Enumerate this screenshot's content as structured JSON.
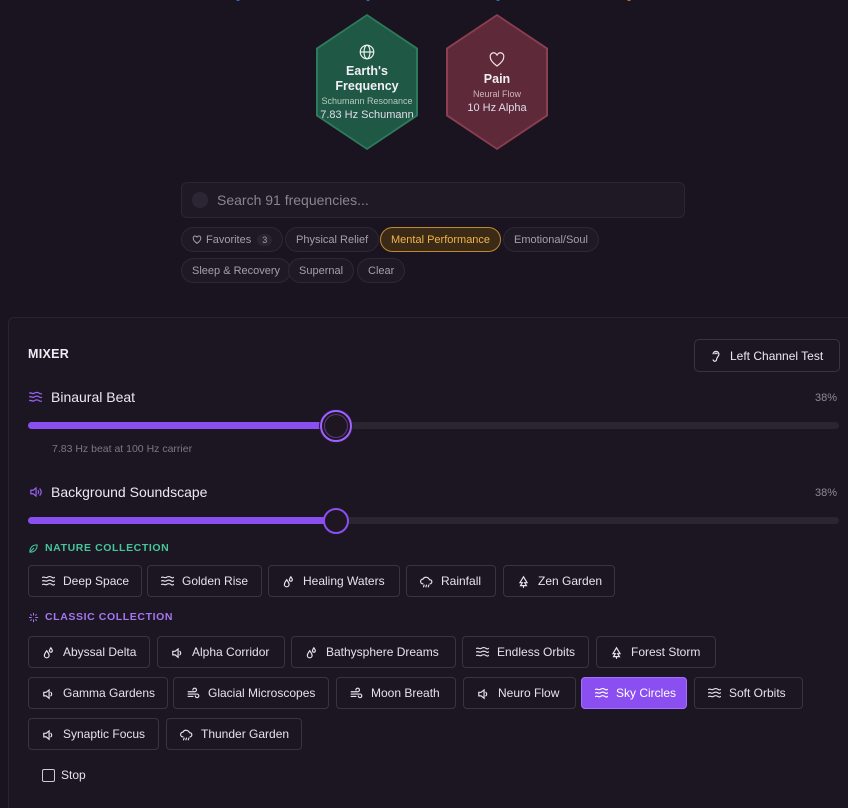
{
  "featured": [
    {
      "title_line1": "Earth's",
      "title_line2": "Frequency",
      "subtitle": "Schumann Resonance",
      "hz": "7.83 Hz Schumann",
      "icon": "globe-icon"
    },
    {
      "title_line1": "Pain",
      "title_line2": "",
      "subtitle": "Neural Flow",
      "hz": "10 Hz Alpha",
      "icon": "heart-icon"
    }
  ],
  "search": {
    "placeholder": "Search 91 frequencies..."
  },
  "filters": {
    "favorites": {
      "label": "Favorites",
      "count": "3"
    },
    "chips": [
      "Physical Relief",
      "Mental Performance",
      "Emotional/Soul",
      "Sleep & Recovery",
      "Supernal",
      "Clear"
    ],
    "active": "Mental Performance"
  },
  "mixer": {
    "title": "MIXER",
    "channel_test_label": "Left Channel Test",
    "binaural": {
      "label": "Binaural Beat",
      "percent": "38%",
      "value": 38,
      "note": "7.83 Hz beat at 100 Hz carrier"
    },
    "background": {
      "label": "Background Soundscape",
      "percent": "38%",
      "value": 38
    },
    "nature_collection": {
      "heading": "NATURE COLLECTION",
      "items": [
        "Deep Space",
        "Golden Rise",
        "Healing Waters",
        "Rainfall",
        "Zen Garden"
      ]
    },
    "classic_collection": {
      "heading": "CLASSIC COLLECTION",
      "items": [
        "Abyssal Delta",
        "Alpha Corridor",
        "Bathysphere Dreams",
        "Endless Orbits",
        "Forest Storm",
        "Gamma Gardens",
        "Glacial Microscopes",
        "Moon Breath",
        "Neuro Flow",
        "Sky Circles",
        "Soft Orbits",
        "Synaptic Focus",
        "Thunder Garden"
      ]
    },
    "selected_sound": "Sky Circles",
    "stop_label": "Stop"
  },
  "colors": {
    "accent": "#8b4ef0",
    "nature": "#45c59a",
    "classic": "#a475ef",
    "active_chip": "#f1b549",
    "earth_hex": "#1f5844",
    "pain_hex": "#5e2a3a"
  }
}
